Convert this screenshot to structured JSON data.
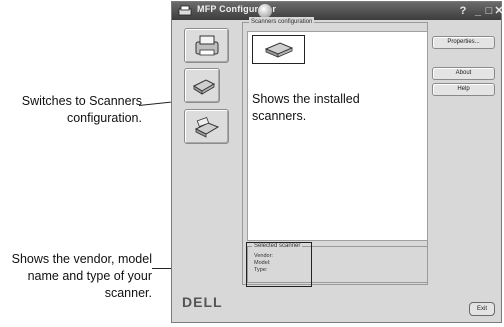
{
  "window": {
    "title": "MFP Configurator",
    "controls": {
      "help": "?",
      "minimize": "_",
      "maximize": "□",
      "close": "✕"
    }
  },
  "callouts": {
    "switch_to_scanners": "Switches to Scanners configuration.",
    "installed_scanners": "Shows the installed scanners.",
    "vendor_info": "Shows the vendor, model name and type of your scanner."
  },
  "nav": [
    {
      "name": "printers-config",
      "icon": "printer-icon"
    },
    {
      "name": "scanners-config",
      "icon": "scanner-icon"
    },
    {
      "name": "ports-config",
      "icon": "port-icon"
    }
  ],
  "scanners_config": {
    "group_label": "Scanners configuration",
    "buttons": {
      "properties": "Properties...",
      "about": "About",
      "help": "Help"
    }
  },
  "selected_scanner": {
    "group_label": "Selected scanner",
    "vendor_label": "Vendor:",
    "model_label": "Model:",
    "type_label": "Type:"
  },
  "footer": {
    "logo": "DELL",
    "exit": "Exit"
  }
}
